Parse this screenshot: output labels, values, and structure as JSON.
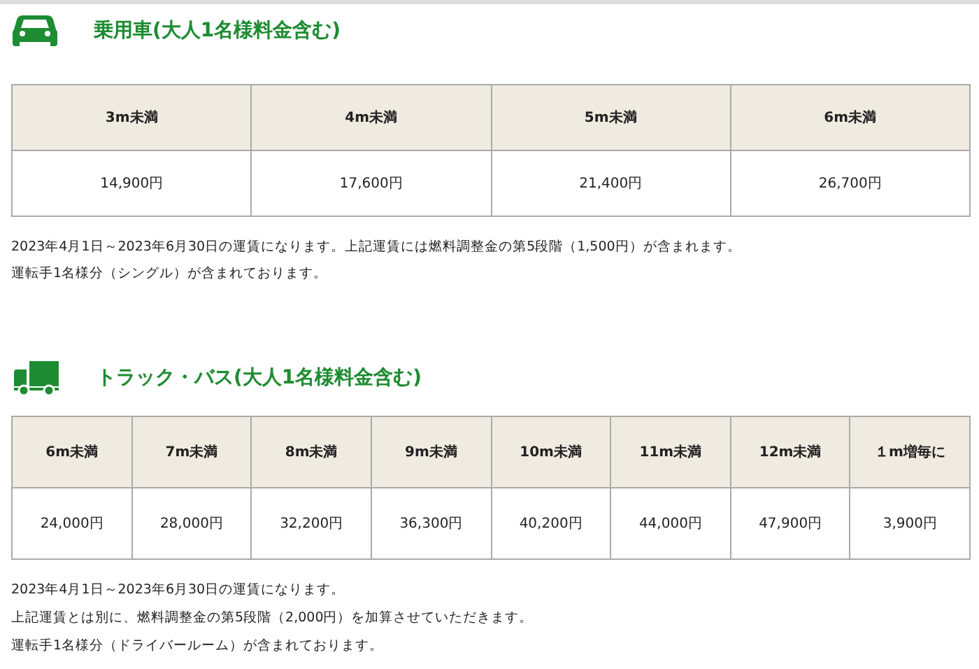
{
  "sections": [
    {
      "kind": "car",
      "title": "乗用車(大人1名様料金含む)",
      "table": {
        "columns": [
          "3m未満",
          "4m未満",
          "5m未満",
          "6m未満"
        ],
        "rows": [
          [
            "14,900円",
            "17,600円",
            "21,400円",
            "26,700円"
          ]
        ]
      },
      "notes": [
        "2023年4月1日～2023年6月30日の運賃になります。上記運賃には燃料調整金の第5段階（1,500円）が含まれます。",
        "運転手1名様分（シングル）が含まれております。"
      ]
    },
    {
      "kind": "truck",
      "title": "トラック・バス(大人1名様料金含む)",
      "table": {
        "columns": [
          "6m未満",
          "7m未満",
          "8m未満",
          "9m未満",
          "10m未満",
          "11m未満",
          "12m未満",
          "１m増毎に"
        ],
        "rows": [
          [
            "24,000円",
            "28,000円",
            "32,200円",
            "36,300円",
            "40,200円",
            "44,000円",
            "47,900円",
            "3,900円"
          ]
        ]
      },
      "notes": [
        "2023年4月1日～2023年6月30日の運賃になります。",
        "上記運賃とは別に、燃料調整金の第5段階（2,000円）を加算させていただきます。",
        "運転手1名様分（ドライバールーム）が含まれております。"
      ]
    }
  ]
}
